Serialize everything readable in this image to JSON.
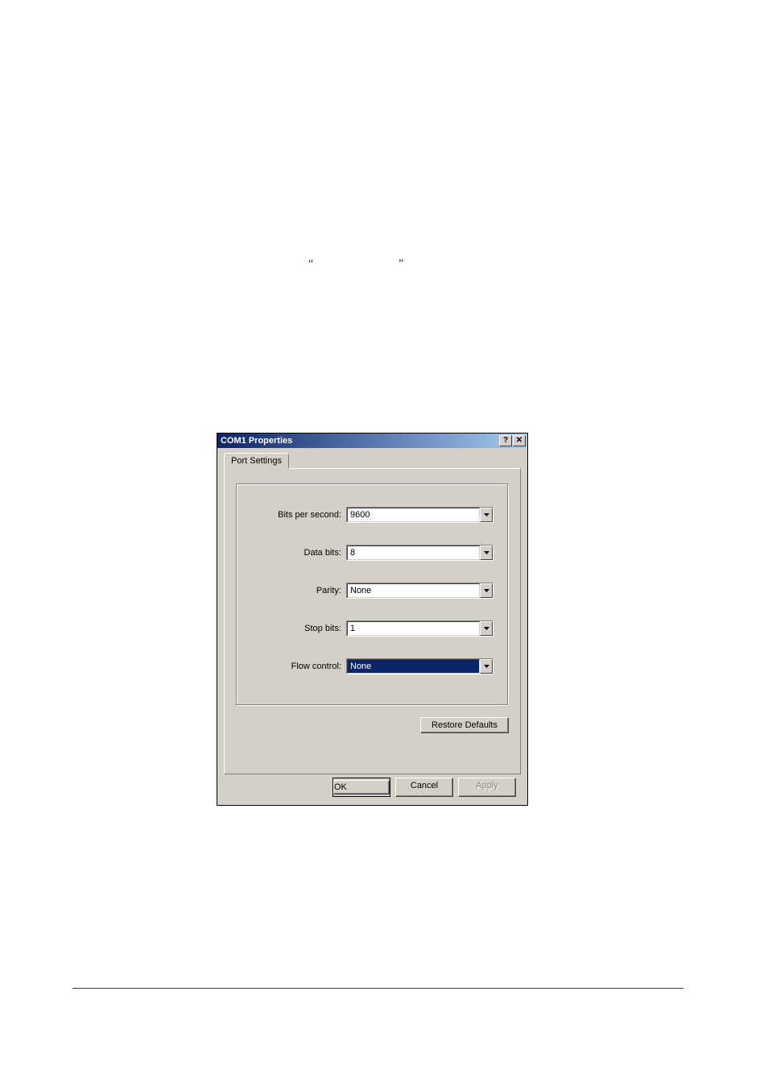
{
  "dialog": {
    "title": "COM1 Properties",
    "help_glyph": "?",
    "close_glyph": "✕",
    "tab": "Port Settings",
    "fields": {
      "bits_per_second": {
        "label": "Bits per second:",
        "value": "9600"
      },
      "data_bits": {
        "label": "Data bits:",
        "value": "8"
      },
      "parity": {
        "label": "Parity:",
        "value": "None"
      },
      "stop_bits": {
        "label": "Stop bits:",
        "value": "1"
      },
      "flow_control": {
        "label": "Flow control:",
        "value": "None"
      }
    },
    "buttons": {
      "restore": "Restore Defaults",
      "ok": "OK",
      "cancel": "Cancel",
      "apply": "Apply"
    }
  },
  "stray": {
    "open_quote": "“",
    "close_quote": "”"
  }
}
